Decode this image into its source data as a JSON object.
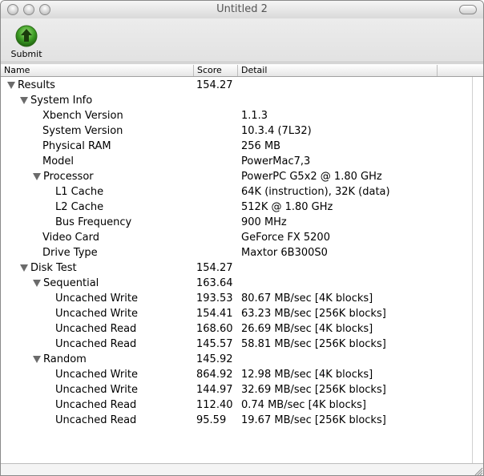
{
  "window": {
    "title": "Untitled 2"
  },
  "toolbar": {
    "submit_label": "Submit"
  },
  "columns": {
    "name": "Name",
    "score": "Score",
    "detail": "Detail"
  },
  "rows": [
    {
      "name": "Results",
      "score": "154.27",
      "detail": "",
      "level": 0,
      "expandable": true
    },
    {
      "name": "System Info",
      "score": "",
      "detail": "",
      "level": 1,
      "expandable": true
    },
    {
      "name": "Xbench Version",
      "score": "",
      "detail": "1.1.3",
      "level": 2,
      "expandable": false
    },
    {
      "name": "System Version",
      "score": "",
      "detail": "10.3.4 (7L32)",
      "level": 2,
      "expandable": false
    },
    {
      "name": "Physical RAM",
      "score": "",
      "detail": "256 MB",
      "level": 2,
      "expandable": false
    },
    {
      "name": "Model",
      "score": "",
      "detail": "PowerMac7,3",
      "level": 2,
      "expandable": false
    },
    {
      "name": "Processor",
      "score": "",
      "detail": "PowerPC G5x2 @ 1.80 GHz",
      "level": 2,
      "expandable": true
    },
    {
      "name": "L1 Cache",
      "score": "",
      "detail": "64K (instruction), 32K (data)",
      "level": 3,
      "expandable": false
    },
    {
      "name": "L2 Cache",
      "score": "",
      "detail": "512K @ 1.80 GHz",
      "level": 3,
      "expandable": false
    },
    {
      "name": "Bus Frequency",
      "score": "",
      "detail": "900 MHz",
      "level": 3,
      "expandable": false
    },
    {
      "name": "Video Card",
      "score": "",
      "detail": "GeForce FX 5200",
      "level": 2,
      "expandable": false
    },
    {
      "name": "Drive Type",
      "score": "",
      "detail": "Maxtor 6B300S0",
      "level": 2,
      "expandable": false
    },
    {
      "name": "Disk Test",
      "score": "154.27",
      "detail": "",
      "level": 1,
      "expandable": true
    },
    {
      "name": "Sequential",
      "score": "163.64",
      "detail": "",
      "level": 2,
      "expandable": true
    },
    {
      "name": "Uncached Write",
      "score": "193.53",
      "detail": "80.67 MB/sec [4K blocks]",
      "level": 3,
      "expandable": false
    },
    {
      "name": "Uncached Write",
      "score": "154.41",
      "detail": "63.23 MB/sec [256K blocks]",
      "level": 3,
      "expandable": false
    },
    {
      "name": "Uncached Read",
      "score": "168.60",
      "detail": "26.69 MB/sec [4K blocks]",
      "level": 3,
      "expandable": false
    },
    {
      "name": "Uncached Read",
      "score": "145.57",
      "detail": "58.81 MB/sec [256K blocks]",
      "level": 3,
      "expandable": false
    },
    {
      "name": "Random",
      "score": "145.92",
      "detail": "",
      "level": 2,
      "expandable": true
    },
    {
      "name": "Uncached Write",
      "score": "864.92",
      "detail": "12.98 MB/sec [4K blocks]",
      "level": 3,
      "expandable": false
    },
    {
      "name": "Uncached Write",
      "score": "144.97",
      "detail": "32.69 MB/sec [256K blocks]",
      "level": 3,
      "expandable": false
    },
    {
      "name": "Uncached Read",
      "score": "112.40",
      "detail": "0.74 MB/sec [4K blocks]",
      "level": 3,
      "expandable": false
    },
    {
      "name": "Uncached Read",
      "score": "95.59",
      "detail": "19.67 MB/sec [256K blocks]",
      "level": 3,
      "expandable": false
    }
  ]
}
